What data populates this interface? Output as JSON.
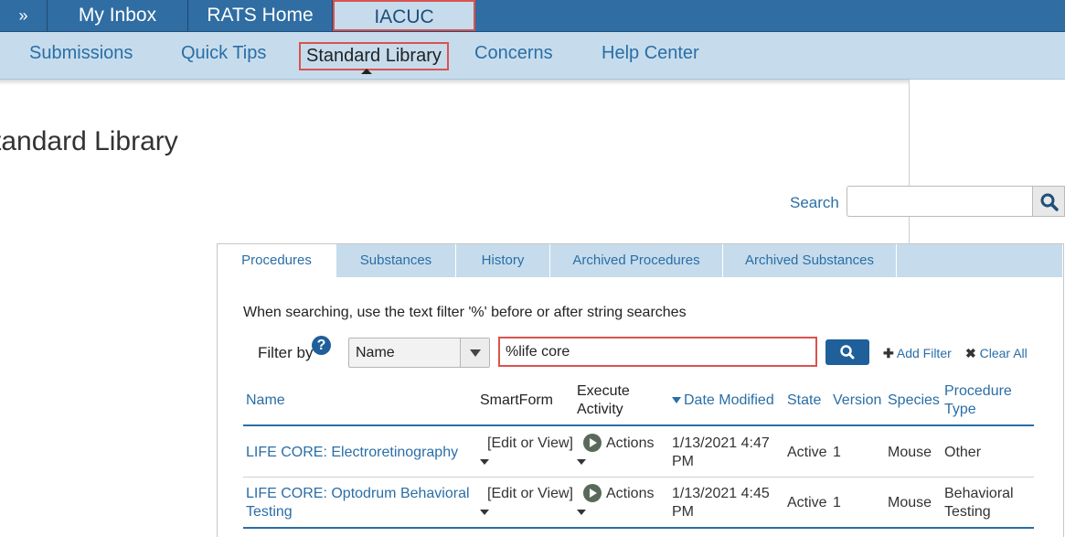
{
  "topnav": {
    "expand_icon": "»",
    "items": [
      "My Inbox",
      "RATS Home",
      "IACUC"
    ]
  },
  "subnav": {
    "items": [
      "Submissions",
      "Quick Tips",
      "Standard Library",
      "Concerns",
      "Help Center"
    ]
  },
  "page": {
    "title": "tandard Library"
  },
  "search": {
    "label": "Search",
    "value": ""
  },
  "tabs": [
    "Procedures",
    "Substances",
    "History",
    "Archived Procedures",
    "Archived Substances"
  ],
  "hint": "When searching, use the text filter '%' before or after string searches",
  "filter": {
    "label": "Filter by",
    "help": "?",
    "field": "Name",
    "value": "%life core",
    "add_filter": "Add Filter",
    "clear_all": "Clear All"
  },
  "table": {
    "headers": {
      "name": "Name",
      "smartform": "SmartForm",
      "execute_1": "Execute",
      "execute_2": "Activity",
      "date": "Date Modified",
      "state": "State",
      "version": "Version",
      "species": "Species",
      "ptype_1": "Procedure",
      "ptype_2": "Type"
    },
    "rows": [
      {
        "name_1": "LIFE CORE: Electroretinography",
        "name_2": "",
        "smartform": "[Edit or View]",
        "actions": "Actions",
        "date_1": "1/13/2021 4:47",
        "date_2": "PM",
        "state": "Active",
        "version": "1",
        "species": "Mouse",
        "ptype_1": "Other",
        "ptype_2": ""
      },
      {
        "name_1": "LIFE CORE: Optodrum Behavioral",
        "name_2": "Testing",
        "smartform": "[Edit or View]",
        "actions": "Actions",
        "date_1": "1/13/2021 4:45",
        "date_2": "PM",
        "state": "Active",
        "version": "1",
        "species": "Mouse",
        "ptype_1": "Behavioral",
        "ptype_2": "Testing"
      }
    ]
  }
}
